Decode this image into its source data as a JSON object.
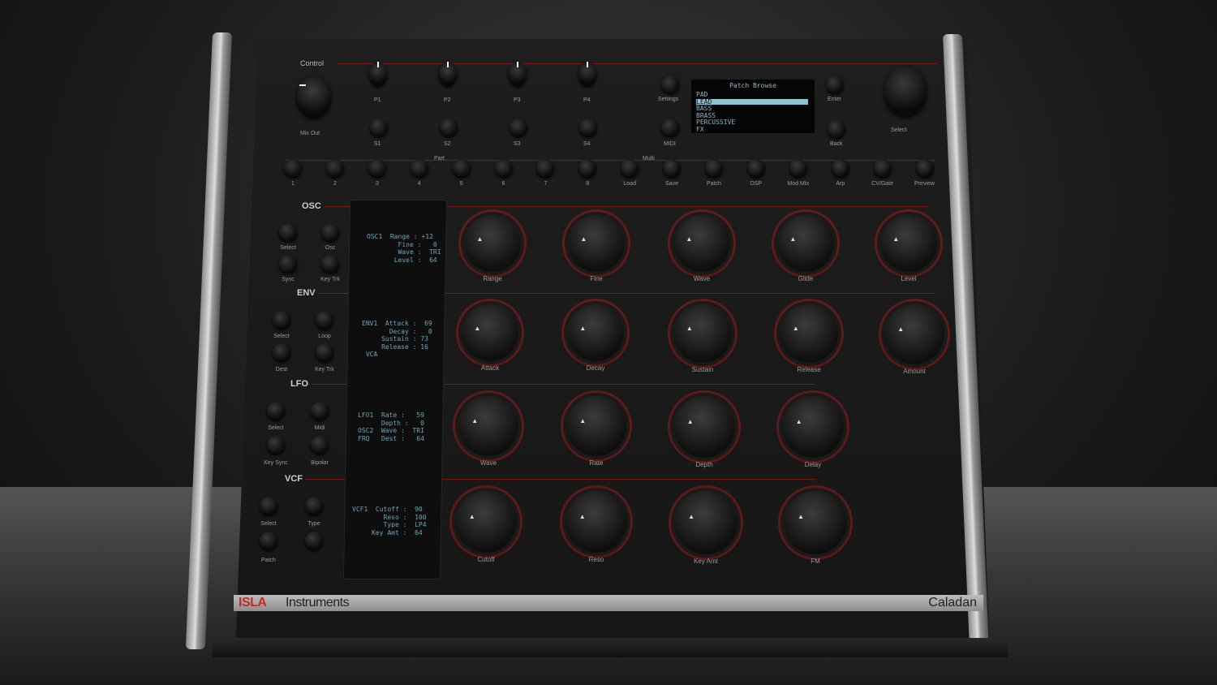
{
  "top": {
    "control_label": "Control",
    "mix_out_label": "Mix Out",
    "param_knobs": [
      "P1",
      "P2",
      "P3",
      "P4"
    ],
    "soft_buttons": [
      "S1",
      "S2",
      "S3",
      "S4"
    ],
    "settings_label": "Settings",
    "midi_label": "MIDI",
    "enter_label": "Enter",
    "back_label": "Back",
    "select_label": "Select"
  },
  "patch_browser": {
    "title": "Patch Browse",
    "items": [
      "PAD",
      "LEAD",
      "BASS",
      "BRASS",
      "PERCUSSIVE",
      "FX"
    ],
    "selected_index": 1
  },
  "part_row": {
    "part_label": "Part",
    "multi_label": "Multi",
    "buttons": [
      "1",
      "2",
      "3",
      "4",
      "5",
      "6",
      "7",
      "8",
      "Load",
      "Save",
      "Patch",
      "DSP",
      "Mod Mtx",
      "Arp",
      "CV/Gate",
      "Preview"
    ]
  },
  "sections": {
    "osc": {
      "title": "OSC",
      "buttons": [
        "Select",
        "Osc",
        "Sync",
        "Key Trk"
      ],
      "knobs": [
        "Range",
        "Fine",
        "Wave",
        "Glide",
        "Level"
      ]
    },
    "env": {
      "title": "ENV",
      "buttons": [
        "Select",
        "Loop",
        "Dest",
        "Key Trk"
      ],
      "knobs": [
        "Attack",
        "Decay",
        "Sustain",
        "Release",
        "Amount"
      ]
    },
    "lfo": {
      "title": "LFO",
      "buttons": [
        "Select",
        "Midi",
        "Key Sync",
        "Bipolar"
      ],
      "knobs": [
        "Wave",
        "Rate",
        "Depth",
        "Delay"
      ]
    },
    "vcf": {
      "title": "VCF",
      "buttons": [
        "Select",
        "Type",
        "Patch",
        ""
      ],
      "knobs": [
        "Cutoff",
        "Reso",
        "Key Amt",
        "FM"
      ]
    }
  },
  "lcd": {
    "osc": "OSC1  Range : +12\n        Fine :   0\n        Wave :  TRI\n       Level :  64",
    "env": "ENV1  Attack :  69\n       Decay :   0\n     Sustain : 73\n     Release : 16\n VCA",
    "lfo": "LFO1  Rate :   59\n      Depth :   0\nOSC2  Wave :  TRI\nFRQ   Dest :   64",
    "vcf": "VCF1  Cutoff :  90\n        Reso :  100\n        Type :  LP4\n     Key Amt :  64"
  },
  "branding": {
    "brand_red": "ISLA",
    "brand": "Instruments",
    "model": "Caladan"
  },
  "colors": {
    "accent_red": "#c62828",
    "lcd_text": "#6fa6b4",
    "panel": "#181818"
  }
}
